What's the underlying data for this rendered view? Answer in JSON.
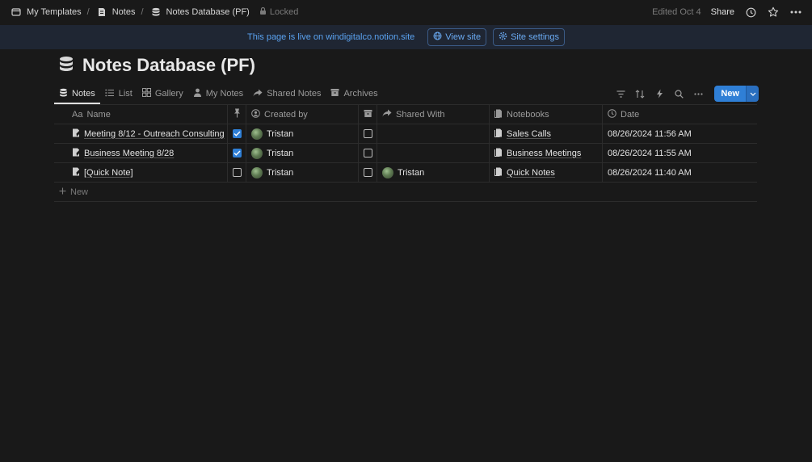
{
  "breadcrumbs": [
    {
      "label": "My Templates",
      "icon": "workspace-icon"
    },
    {
      "label": "Notes",
      "icon": "page-icon"
    },
    {
      "label": "Notes Database (PF)",
      "icon": "database-icon"
    }
  ],
  "locked_label": "Locked",
  "edited_label": "Edited Oct 4",
  "share_label": "Share",
  "banner": {
    "text": "This page is live on windigitalco.notion.site",
    "view_site": "View site",
    "site_settings": "Site settings"
  },
  "page_title": "Notes Database (PF)",
  "views": [
    {
      "label": "Notes",
      "icon": "database-icon",
      "active": true
    },
    {
      "label": "List",
      "icon": "list-icon"
    },
    {
      "label": "Gallery",
      "icon": "gallery-icon"
    },
    {
      "label": "My Notes",
      "icon": "person-icon"
    },
    {
      "label": "Shared Notes",
      "icon": "share-arrow-icon"
    },
    {
      "label": "Archives",
      "icon": "archive-icon"
    }
  ],
  "new_button": "New",
  "columns": {
    "name": "Name",
    "name_prefix": "Aa",
    "created_by": "Created by",
    "shared_with": "Shared With",
    "notebooks": "Notebooks",
    "date": "Date"
  },
  "rows": [
    {
      "name": "Meeting 8/12 - Outreach Consulting",
      "pinned": true,
      "created_by": "Tristan",
      "archived": false,
      "shared_with": "",
      "notebook": "Sales Calls",
      "date": "08/26/2024 11:56 AM"
    },
    {
      "name": "Business Meeting 8/28",
      "pinned": true,
      "created_by": "Tristan",
      "archived": false,
      "shared_with": "",
      "notebook": "Business Meetings",
      "date": "08/26/2024 11:55 AM"
    },
    {
      "name": "[Quick Note]",
      "pinned": false,
      "created_by": "Tristan",
      "archived": false,
      "shared_with": "Tristan",
      "notebook": "Quick Notes",
      "date": "08/26/2024 11:40 AM"
    }
  ],
  "new_row_label": "New",
  "colors": {
    "background": "#191919",
    "accent": "#2f7fd6",
    "banner_bg": "#1f2633",
    "banner_text": "#5aa2f0"
  }
}
